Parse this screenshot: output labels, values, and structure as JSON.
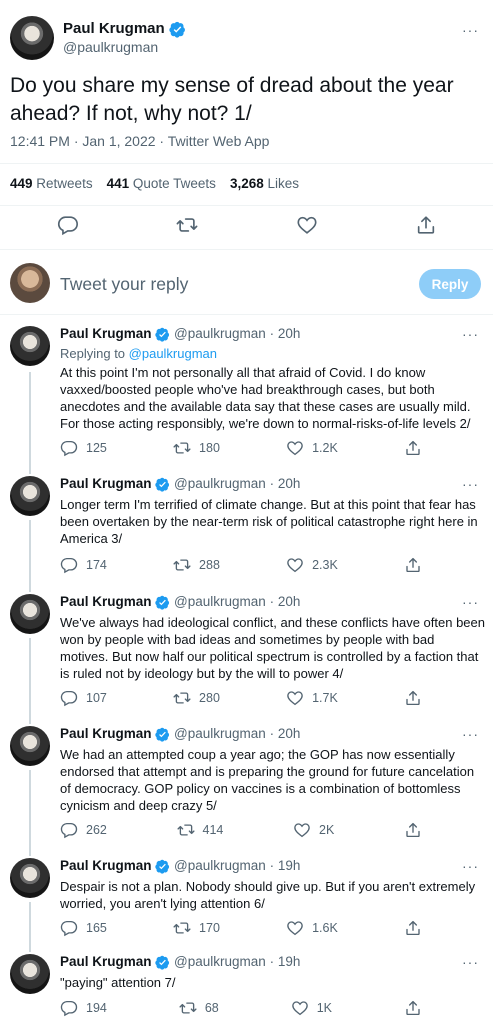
{
  "main_tweet": {
    "name": "Paul Krugman",
    "handle": "@paulkrugman",
    "more": "···",
    "text": "Do you share my sense of dread about the year ahead? If not, why not? 1/",
    "meta": "12:41 PM · Jan 1, 2022 · Twitter Web App",
    "retweets": "449",
    "retweets_label": "Retweets",
    "quotes": "441",
    "quotes_label": "Quote Tweets",
    "likes": "3,268",
    "likes_label": "Likes"
  },
  "composer": {
    "placeholder": "Tweet your reply",
    "button": "Reply"
  },
  "thread": [
    {
      "name": "Paul Krugman",
      "handle": "@paulkrugman",
      "time": "· 20h",
      "replying_prefix": "Replying to ",
      "replying_to": "@paulkrugman",
      "text": "At this point I'm not personally all that afraid of Covid. I do know vaxxed/boosted people who've had breakthrough cases, but both anecdotes and the available data say that these cases are usually mild. For those acting responsibly, we're down to normal-risks-of-life levels 2/",
      "replies": "125",
      "retweets": "180",
      "likes": "1.2K"
    },
    {
      "name": "Paul Krugman",
      "handle": "@paulkrugman",
      "time": "· 20h",
      "text": "Longer term I'm terrified of climate change. But at this point that fear has been overtaken by the near-term risk of political catastrophe right here in America 3/",
      "replies": "174",
      "retweets": "288",
      "likes": "2.3K"
    },
    {
      "name": "Paul Krugman",
      "handle": "@paulkrugman",
      "time": "· 20h",
      "text": "We've always had ideological conflict, and these conflicts have often been won by people with bad ideas and sometimes by people with bad motives. But now half our political spectrum is controlled by a faction that is ruled not by ideology but by the will to power 4/",
      "replies": "107",
      "retweets": "280",
      "likes": "1.7K"
    },
    {
      "name": "Paul Krugman",
      "handle": "@paulkrugman",
      "time": "· 20h",
      "text": "We had an attempted coup a year ago; the GOP has now essentially endorsed that attempt and is preparing the ground for future cancelation of democracy. GOP policy on vaccines is a combination of bottomless cynicism and deep crazy 5/",
      "replies": "262",
      "retweets": "414",
      "likes": "2K"
    },
    {
      "name": "Paul Krugman",
      "handle": "@paulkrugman",
      "time": "· 19h",
      "text": "Despair is not a plan. Nobody should give up. But if you aren't extremely worried, you aren't lying attention 6/",
      "replies": "165",
      "retweets": "170",
      "likes": "1.6K"
    },
    {
      "name": "Paul Krugman",
      "handle": "@paulkrugman",
      "time": "· 19h",
      "text": "\"paying\" attention 7/",
      "replies": "194",
      "retweets": "68",
      "likes": "1K"
    }
  ],
  "colors": {
    "accent": "#1d9bf0",
    "muted": "#536471",
    "reply_disabled": "#8ecdf8"
  },
  "icons": [
    "verified-badge-icon",
    "more-icon",
    "reply-icon",
    "retweet-icon",
    "like-icon",
    "share-icon"
  ]
}
